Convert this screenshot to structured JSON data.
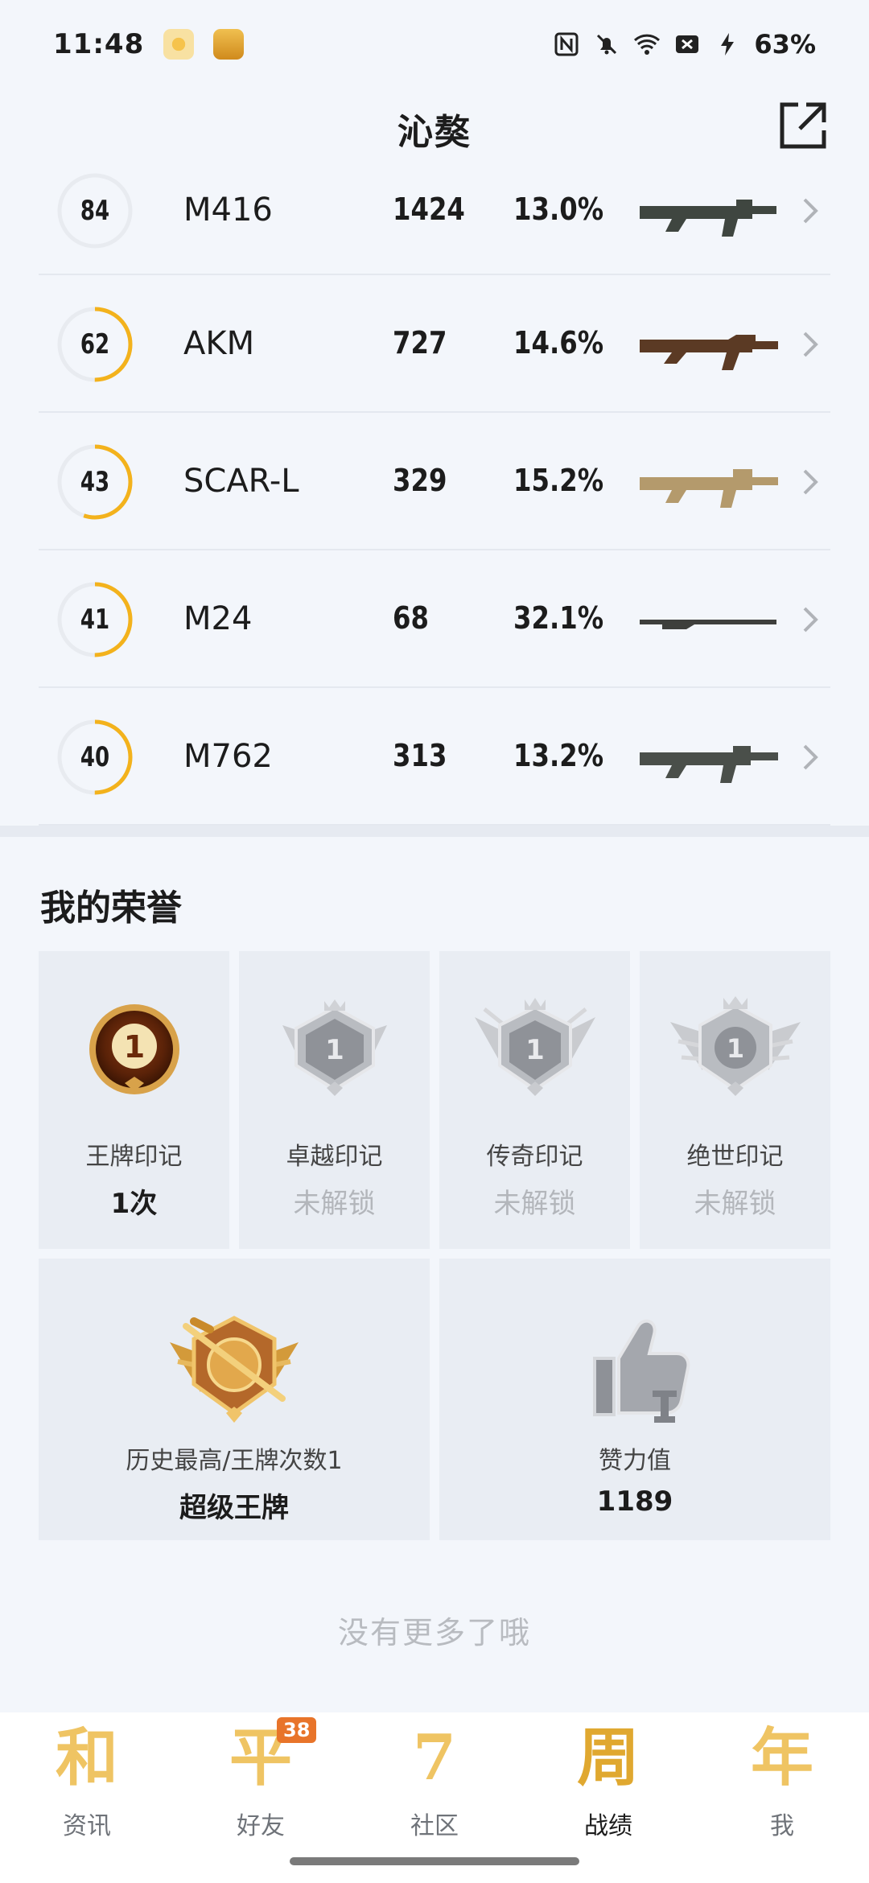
{
  "status_bar": {
    "time": "11:48",
    "battery": "63%"
  },
  "header": {
    "title": "沁獒"
  },
  "weapons": [
    {
      "level": "84",
      "name": "M416",
      "kills": "1424",
      "rate": "13.0%",
      "progress": 0.0
    },
    {
      "level": "62",
      "name": "AKM",
      "kills": "727",
      "rate": "14.6%",
      "progress": 0.5
    },
    {
      "level": "43",
      "name": "SCAR-L",
      "kills": "329",
      "rate": "15.2%",
      "progress": 0.55
    },
    {
      "level": "41",
      "name": "M24",
      "kills": "68",
      "rate": "32.1%",
      "progress": 0.5
    },
    {
      "level": "40",
      "name": "M762",
      "kills": "313",
      "rate": "13.2%",
      "progress": 0.5
    }
  ],
  "honor": {
    "title": "我的荣誉",
    "marks": [
      {
        "label": "王牌印记",
        "value": "1次",
        "locked": false
      },
      {
        "label": "卓越印记",
        "value": "未解锁",
        "locked": true
      },
      {
        "label": "传奇印记",
        "value": "未解锁",
        "locked": true
      },
      {
        "label": "绝世印记",
        "value": "未解锁",
        "locked": true
      }
    ],
    "best": {
      "label": "历史最高/王牌次数1",
      "value": "超级王牌"
    },
    "likes": {
      "label": "赞力值",
      "value": "1189"
    }
  },
  "footer_text": "没有更多了哦",
  "bottom_nav": [
    {
      "glyph": "和",
      "label": "资讯"
    },
    {
      "glyph": "平",
      "label": "好友",
      "badge": "38"
    },
    {
      "glyph": "7",
      "label": "社区"
    },
    {
      "glyph": "周",
      "label": "战绩"
    },
    {
      "glyph": "年",
      "label": "我"
    }
  ],
  "colors": {
    "accent": "#f3b21c",
    "bg": "#f3f6fb"
  }
}
